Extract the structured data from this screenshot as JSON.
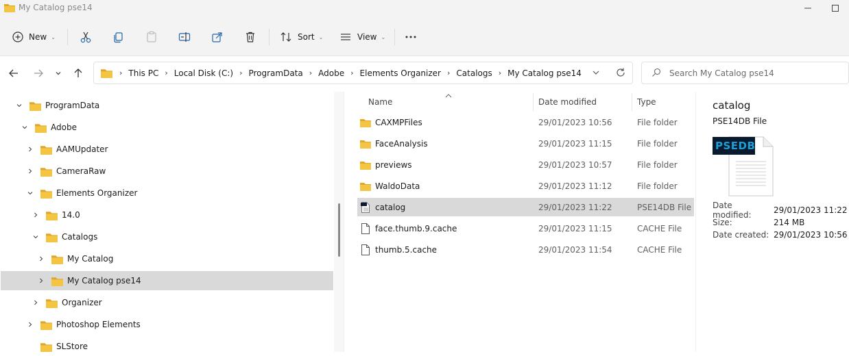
{
  "window": {
    "title": "My Catalog pse14"
  },
  "toolbar": {
    "new_label": "New",
    "sort_label": "Sort",
    "view_label": "View"
  },
  "address": {
    "crumbs": [
      "This PC",
      "Local Disk (C:)",
      "ProgramData",
      "Adobe",
      "Elements Organizer",
      "Catalogs",
      "My Catalog pse14"
    ]
  },
  "search": {
    "placeholder": "Search My Catalog pse14"
  },
  "tree": {
    "items": [
      {
        "label": "ProgramData",
        "state": "expanded"
      },
      {
        "label": "Adobe",
        "state": "expanded"
      },
      {
        "label": "AAMUpdater",
        "state": "collapsed"
      },
      {
        "label": "CameraRaw",
        "state": "collapsed"
      },
      {
        "label": "Elements Organizer",
        "state": "expanded"
      },
      {
        "label": "14.0",
        "state": "collapsed"
      },
      {
        "label": "Catalogs",
        "state": "expanded"
      },
      {
        "label": "My Catalog",
        "state": "collapsed"
      },
      {
        "label": "My Catalog pse14",
        "state": "collapsed",
        "selected": true
      },
      {
        "label": "Organizer",
        "state": "collapsed"
      },
      {
        "label": "Photoshop Elements",
        "state": "collapsed"
      },
      {
        "label": "SLStore",
        "state": "none"
      }
    ]
  },
  "columns": {
    "name": "Name",
    "date": "Date modified",
    "type": "Type"
  },
  "files": [
    {
      "name": "CAXMPFiles",
      "date": "29/01/2023 10:56",
      "type": "File folder",
      "icon": "folder-icon"
    },
    {
      "name": "FaceAnalysis",
      "date": "29/01/2023 11:15",
      "type": "File folder",
      "icon": "folder-icon"
    },
    {
      "name": "previews",
      "date": "29/01/2023 10:57",
      "type": "File folder",
      "icon": "folder-icon"
    },
    {
      "name": "WaldoData",
      "date": "29/01/2023 11:12",
      "type": "File folder",
      "icon": "folder-icon"
    },
    {
      "name": "catalog",
      "date": "29/01/2023 11:22",
      "type": "PSE14DB File",
      "icon": "psedb-file-icon",
      "selected": true
    },
    {
      "name": "face.thumb.9.cache",
      "date": "29/01/2023 11:15",
      "type": "CACHE File",
      "icon": "file-icon"
    },
    {
      "name": "thumb.5.cache",
      "date": "29/01/2023 11:54",
      "type": "CACHE File",
      "icon": "file-icon"
    }
  ],
  "details": {
    "title": "catalog",
    "subtitle": "PSE14DB File",
    "thumb_badge": "PSEDB",
    "props": [
      {
        "key": "Date modified:",
        "value": "29/01/2023 11:22"
      },
      {
        "key": "Size:",
        "value": "214 MB"
      },
      {
        "key": "Date created:",
        "value": "29/01/2023 10:56"
      }
    ]
  },
  "colors": {
    "folder": "#f4c542",
    "folder_dark": "#e0a826",
    "selection": "#d9d9d9",
    "psedb_badge": "#1b9fd8"
  }
}
